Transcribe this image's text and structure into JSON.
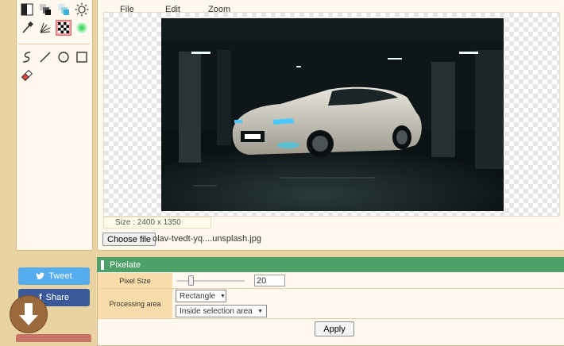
{
  "menu": {
    "file": "File",
    "edit": "Edit",
    "zoom": "Zoom"
  },
  "tools": [
    {
      "name": "contrast-icon"
    },
    {
      "name": "grayscale-icon"
    },
    {
      "name": "color-balance-icon"
    },
    {
      "name": "brightness-icon"
    },
    {
      "name": "eyedropper-icon"
    },
    {
      "name": "blur-icon"
    },
    {
      "name": "pixelate-icon",
      "selected": true
    },
    {
      "name": "spotlight-icon"
    },
    {
      "name": "freehand-icon"
    },
    {
      "name": "line-icon"
    },
    {
      "name": "circle-icon"
    },
    {
      "name": "rectangle-icon"
    },
    {
      "name": "eraser-icon"
    }
  ],
  "image": {
    "size_label": "Size : 2400 x 1350"
  },
  "file": {
    "choose_label": "Choose file",
    "filename": "olav-tvedt-yq....unsplash.jpg"
  },
  "social": {
    "tweet": "Tweet",
    "share": "Share"
  },
  "pixelate": {
    "title": "Pixelate",
    "pixel_size_label": "Pixel Size",
    "pixel_size_value": "20",
    "processing_area_label": "Processing area",
    "shape_value": "Rectangle",
    "area_value": "Inside selection area",
    "apply_label": "Apply"
  },
  "colors": {
    "panel_header": "#4ea069",
    "label_bg": "#f9dcaa",
    "tweet": "#55acee",
    "share": "#3b5998",
    "background": "#e9d3a3"
  }
}
